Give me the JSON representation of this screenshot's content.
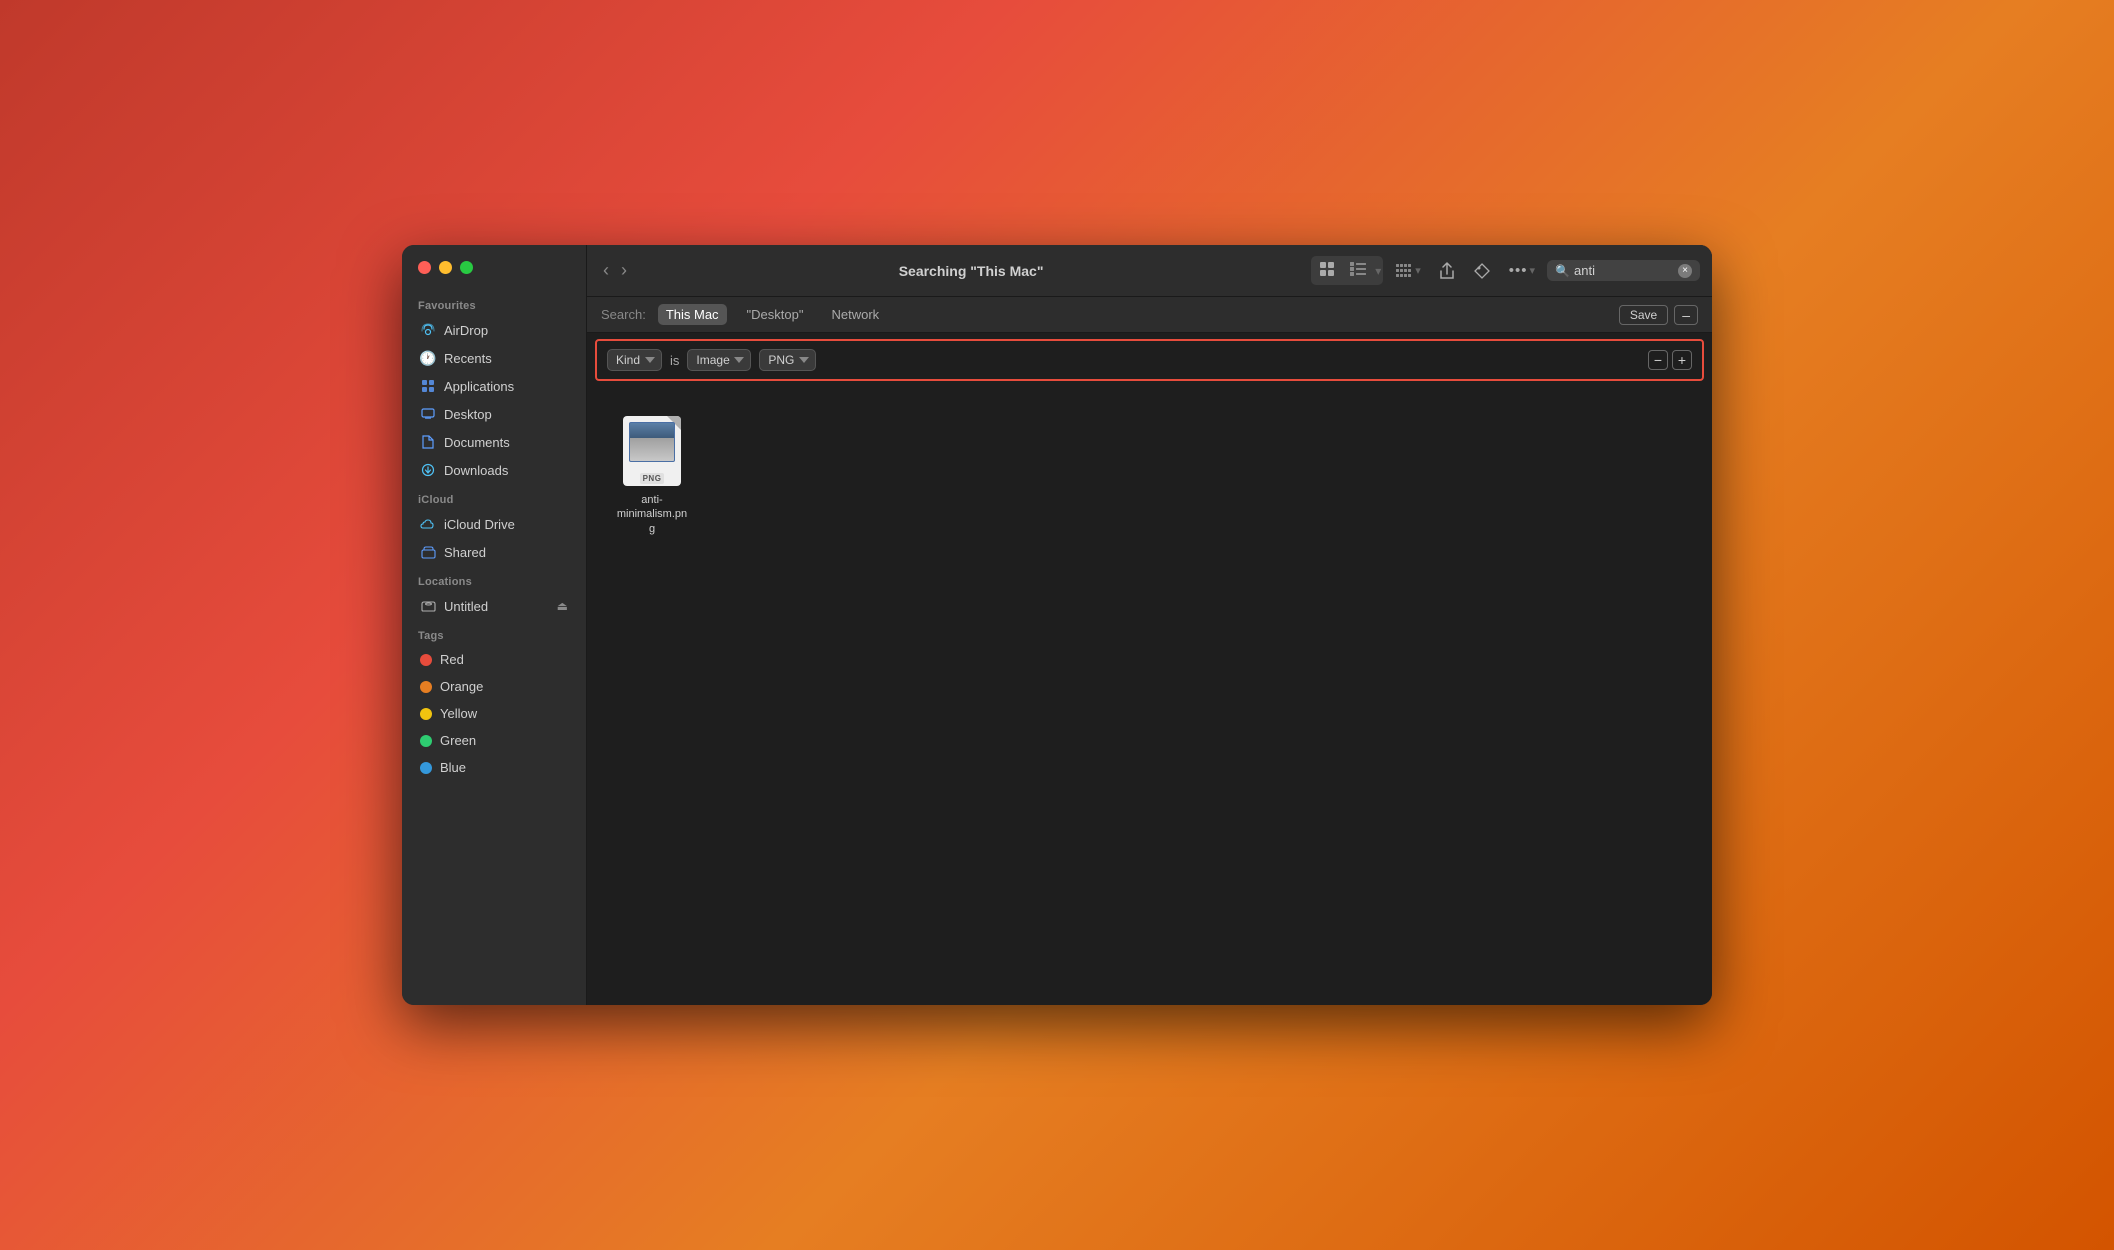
{
  "window": {
    "title": "Searching \"This Mac\""
  },
  "toolbar": {
    "back_label": "‹",
    "forward_label": "›",
    "title": "Searching \"This Mac\"",
    "view_icon_grid": "⊞",
    "view_icon_list": "⊟",
    "share_icon": "↑",
    "tag_icon": "⬡",
    "more_icon": "···",
    "search_placeholder": "anti",
    "search_value": "anti",
    "clear_icon": "×"
  },
  "search_scope": {
    "label": "Search:",
    "options": [
      {
        "id": "this-mac",
        "label": "This Mac",
        "active": true
      },
      {
        "id": "desktop",
        "label": "\"Desktop\"",
        "active": false
      },
      {
        "id": "network",
        "label": "Network",
        "active": false
      }
    ],
    "save_label": "Save",
    "minus_label": "–"
  },
  "filter_row": {
    "kind_label": "Kind",
    "is_label": "is",
    "type_label": "Image",
    "subtype_label": "PNG",
    "remove_label": "−",
    "add_label": "+"
  },
  "sidebar": {
    "favourites_label": "Favourites",
    "items_favourites": [
      {
        "id": "airdrop",
        "label": "AirDrop",
        "icon": "airdrop"
      },
      {
        "id": "recents",
        "label": "Recents",
        "icon": "recents"
      },
      {
        "id": "applications",
        "label": "Applications",
        "icon": "applications"
      },
      {
        "id": "desktop",
        "label": "Desktop",
        "icon": "desktop"
      },
      {
        "id": "documents",
        "label": "Documents",
        "icon": "documents"
      },
      {
        "id": "downloads",
        "label": "Downloads",
        "icon": "downloads"
      }
    ],
    "icloud_label": "iCloud",
    "items_icloud": [
      {
        "id": "icloud-drive",
        "label": "iCloud Drive",
        "icon": "icloud"
      },
      {
        "id": "shared",
        "label": "Shared",
        "icon": "shared"
      }
    ],
    "locations_label": "Locations",
    "items_locations": [
      {
        "id": "untitled",
        "label": "Untitled",
        "icon": "untitled",
        "eject": true
      }
    ],
    "tags_label": "Tags",
    "tags": [
      {
        "id": "red",
        "label": "Red",
        "color": "#e74c3c"
      },
      {
        "id": "orange",
        "label": "Orange",
        "color": "#e67e22"
      },
      {
        "id": "yellow",
        "label": "Yellow",
        "color": "#f1c40f"
      },
      {
        "id": "green",
        "label": "Green",
        "color": "#2ecc71"
      },
      {
        "id": "blue",
        "label": "Blue",
        "color": "#3498db"
      }
    ]
  },
  "file_area": {
    "files": [
      {
        "id": "anti-minimalism",
        "name": "anti-\nminimalism.png",
        "type": "png"
      }
    ]
  }
}
